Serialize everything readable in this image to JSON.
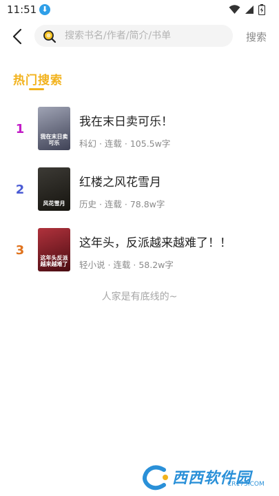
{
  "status_bar": {
    "time": "11:51",
    "download_glyph": "⬇"
  },
  "header": {
    "search_placeholder": "搜索书名/作者/简介/书单",
    "search_button": "搜索"
  },
  "section": {
    "title": "热门搜索"
  },
  "books": [
    {
      "rank": "1",
      "rank_color": "#c21cc7",
      "title": "我在末日卖可乐！",
      "meta": "科幻 · 连载 · 105.5w字",
      "cover_text": "我在末日卖可乐",
      "cover_colors": [
        "#9fa3b4",
        "#3f4256"
      ]
    },
    {
      "rank": "2",
      "rank_color": "#4a5bd4",
      "title": "红楼之风花雪月",
      "meta": "历史 · 连载 · 78.8w字",
      "cover_text": "风花雪月",
      "cover_colors": [
        "#3c3a35",
        "#16140f"
      ]
    },
    {
      "rank": "3",
      "rank_color": "#e0731e",
      "title": "这年头，反派越来越难了！！",
      "meta": "轻小说 · 连载 · 58.2w字",
      "cover_text": "这年头反派越来越难了",
      "cover_colors": [
        "#b0323c",
        "#4a0c12"
      ]
    }
  ],
  "footer": {
    "note": "人家是有底线的~"
  },
  "watermark": {
    "name": "西西软件园",
    "url": "CR173.COM"
  }
}
